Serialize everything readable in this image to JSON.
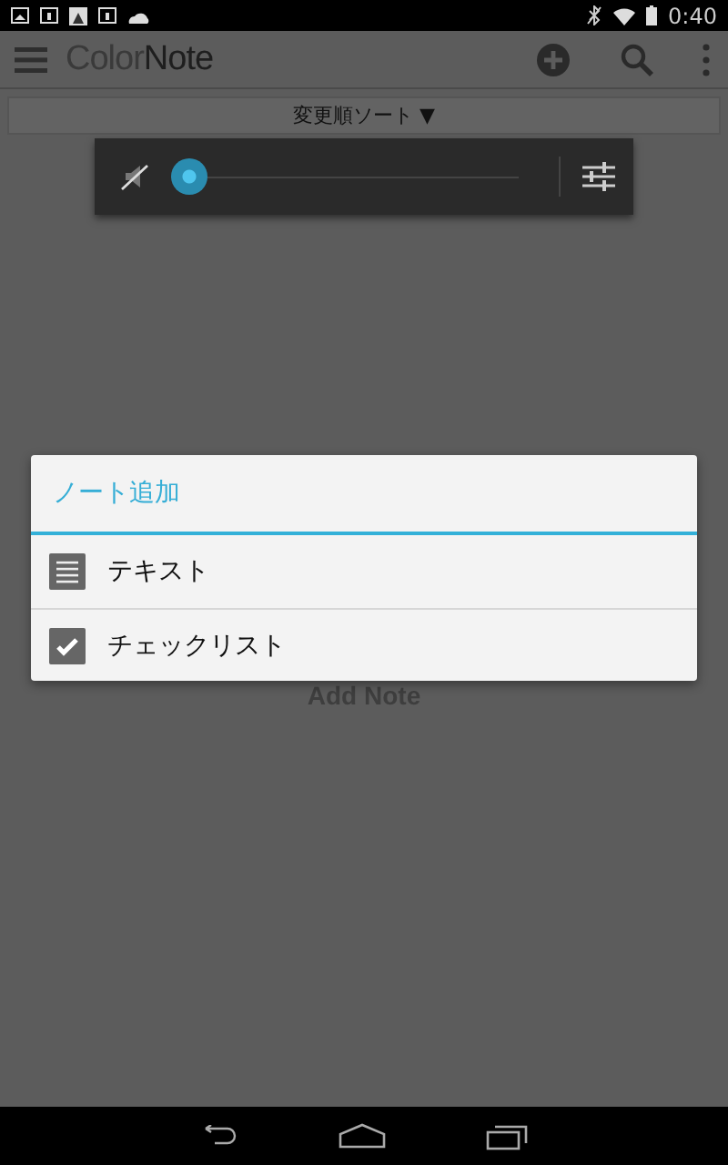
{
  "status_bar": {
    "time": "0:40"
  },
  "app_bar": {
    "title_light": "Color",
    "title_dark": "Note"
  },
  "sort_bar": {
    "label": "変更順ソート ▼"
  },
  "volume_popup": {
    "muted": true,
    "level": 0
  },
  "empty_state": {
    "label": "Add Note"
  },
  "dialog": {
    "title": "ノート追加",
    "items": [
      {
        "kind": "text",
        "label": "テキスト"
      },
      {
        "kind": "checklist",
        "label": "チェックリスト"
      }
    ]
  }
}
